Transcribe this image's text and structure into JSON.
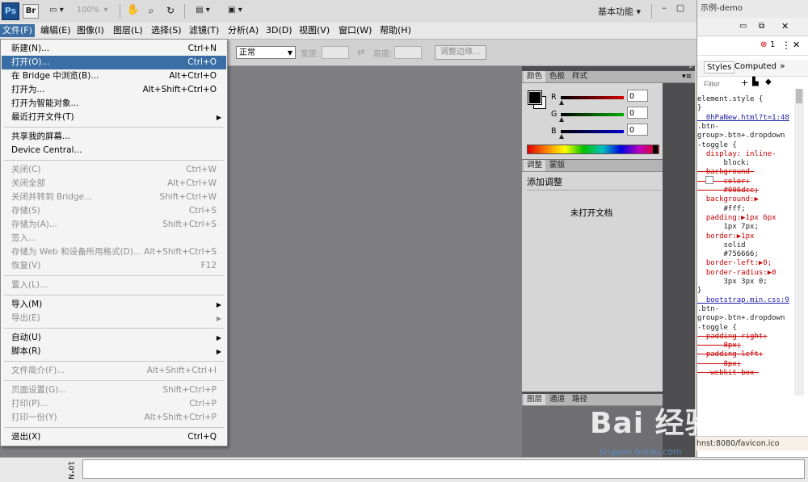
{
  "appbar": {
    "logo": "Ps",
    "bridge": "Br",
    "zoom": "100%",
    "workspace": "基本功能 ▾",
    "browser_tab": "示例-demo"
  },
  "menubar": {
    "items": [
      "文件(F)",
      "编辑(E)",
      "图像(I)",
      "图层(L)",
      "选择(S)",
      "滤镜(T)",
      "分析(A)",
      "3D(D)",
      "视图(V)",
      "窗口(W)",
      "帮助(H)"
    ]
  },
  "options": {
    "style_value": "正常",
    "width_label": "宽度:",
    "height_label": "高度:",
    "refine_button": "调整边缘..."
  },
  "file_menu": {
    "items": [
      {
        "label": "新建(N)...",
        "shortcut": "Ctrl+N",
        "disabled": false
      },
      {
        "label": "打开(O)...",
        "shortcut": "Ctrl+O",
        "disabled": false,
        "highlight": true
      },
      {
        "label": "在 Bridge 中浏览(B)...",
        "shortcut": "Alt+Ctrl+O",
        "disabled": false
      },
      {
        "label": "打开为...",
        "shortcut": "Alt+Shift+Ctrl+O",
        "disabled": false
      },
      {
        "label": "打开为智能对象...",
        "shortcut": "",
        "disabled": false
      },
      {
        "label": "最近打开文件(T)",
        "shortcut": "",
        "disabled": false,
        "submenu": true
      },
      {
        "sep": true
      },
      {
        "label": "共享我的屏幕...",
        "shortcut": "",
        "disabled": false
      },
      {
        "label": "Device Central...",
        "shortcut": "",
        "disabled": false
      },
      {
        "sep": true
      },
      {
        "label": "关闭(C)",
        "shortcut": "Ctrl+W",
        "disabled": true
      },
      {
        "label": "关闭全部",
        "shortcut": "Alt+Ctrl+W",
        "disabled": true
      },
      {
        "label": "关闭并转到 Bridge...",
        "shortcut": "Shift+Ctrl+W",
        "disabled": true
      },
      {
        "label": "存储(S)",
        "shortcut": "Ctrl+S",
        "disabled": true
      },
      {
        "label": "存储为(A)...",
        "shortcut": "Shift+Ctrl+S",
        "disabled": true
      },
      {
        "label": "签入...",
        "shortcut": "",
        "disabled": true
      },
      {
        "label": "存储为 Web 和设备所用格式(D)...",
        "shortcut": "Alt+Shift+Ctrl+S",
        "disabled": true
      },
      {
        "label": "恢复(V)",
        "shortcut": "F12",
        "disabled": true
      },
      {
        "sep": true
      },
      {
        "label": "置入(L)...",
        "shortcut": "",
        "disabled": true
      },
      {
        "sep": true
      },
      {
        "label": "导入(M)",
        "shortcut": "",
        "disabled": false,
        "submenu": true
      },
      {
        "label": "导出(E)",
        "shortcut": "",
        "disabled": true,
        "submenu": true
      },
      {
        "sep": true
      },
      {
        "label": "自动(U)",
        "shortcut": "",
        "disabled": false,
        "submenu": true
      },
      {
        "label": "脚本(R)",
        "shortcut": "",
        "disabled": false,
        "submenu": true
      },
      {
        "sep": true
      },
      {
        "label": "文件简介(F)...",
        "shortcut": "Alt+Shift+Ctrl+I",
        "disabled": true
      },
      {
        "sep": true
      },
      {
        "label": "页面设置(G)...",
        "shortcut": "Shift+Ctrl+P",
        "disabled": true
      },
      {
        "label": "打印(P)...",
        "shortcut": "Ctrl+P",
        "disabled": true
      },
      {
        "label": "打印一份(Y)",
        "shortcut": "Alt+Shift+Ctrl+P",
        "disabled": true
      },
      {
        "sep": true
      },
      {
        "label": "退出(X)",
        "shortcut": "Ctrl+Q",
        "disabled": false
      }
    ]
  },
  "color_panel": {
    "tabs": [
      "颜色",
      "色板",
      "样式"
    ],
    "r_label": "R",
    "g_label": "G",
    "b_label": "B",
    "r": "0",
    "g": "0",
    "b": "0",
    "colors": {
      "fg": "#000000",
      "bg": "#ffffff",
      "r_slider": "#d00000",
      "g_slider": "#00b000",
      "b_slider": "#0000d0"
    }
  },
  "adjust_panel": {
    "tabs": [
      "调整",
      "蒙版"
    ],
    "title": "添加调整",
    "empty": "未打开文档"
  },
  "layers_panel": {
    "tabs": [
      "图层",
      "通道",
      "路径"
    ]
  },
  "devtools": {
    "tabs": [
      "Styles",
      "Computed"
    ],
    "error_count": "1",
    "filter_placeholder": "Filter",
    "lines": [
      {
        "t": "element.style {",
        "c": ""
      },
      {
        "t": "}",
        "c": ""
      },
      {
        "t": "  0hPaNew.html?t=1:48",
        "c": "link"
      },
      {
        "t": ".btn-",
        "c": ""
      },
      {
        "t": "group>.btn+.dropdown",
        "c": ""
      },
      {
        "t": "-toggle {",
        "c": ""
      },
      {
        "t": "  display: inline-",
        "c": "prop"
      },
      {
        "t": "      block;",
        "c": ""
      },
      {
        "t": "  background-",
        "c": "strike"
      },
      {
        "t": "      color:",
        "c": "strike"
      },
      {
        "t": "      #006dcc;",
        "c": "strike"
      },
      {
        "t": "  background:▶",
        "c": "prop"
      },
      {
        "t": "      #fff;",
        "c": ""
      },
      {
        "t": "  padding:▶1px 6px",
        "c": "prop"
      },
      {
        "t": "      1px 7px;",
        "c": ""
      },
      {
        "t": "  border:▶1px",
        "c": "prop"
      },
      {
        "t": "      solid",
        "c": ""
      },
      {
        "t": "      #756666;",
        "c": ""
      },
      {
        "t": "  border-left:▶0;",
        "c": "prop"
      },
      {
        "t": "  border-radius:▶0",
        "c": "prop"
      },
      {
        "t": "      3px 3px 0;",
        "c": ""
      },
      {
        "t": "}",
        "c": ""
      },
      {
        "t": "  bootstrap.min.css:9",
        "c": "link"
      },
      {
        "t": ".btn-",
        "c": ""
      },
      {
        "t": "group>.btn+.dropdown",
        "c": ""
      },
      {
        "t": "-toggle {",
        "c": ""
      },
      {
        "t": "  padding-right:",
        "c": "strike"
      },
      {
        "t": "      8px;",
        "c": "strike"
      },
      {
        "t": "  padding-left:",
        "c": "strike"
      },
      {
        "t": "      8px;",
        "c": "strike"
      },
      {
        "t": "  -webkit-box-",
        "c": "strike"
      }
    ],
    "url": "hnst:8080/favicon.ico"
  },
  "watermark": {
    "main": "Bai 经验",
    "sub": "jingyan.baidu.com"
  }
}
